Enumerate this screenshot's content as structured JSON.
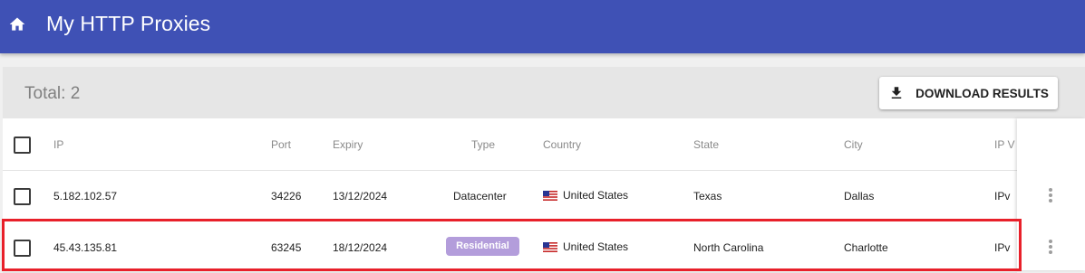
{
  "appbar": {
    "title": "My HTTP Proxies",
    "color": "#3f51b5"
  },
  "toolbar": {
    "total": "Total: 2",
    "download_label": "DOWNLOAD RESULTS"
  },
  "table": {
    "headers": {
      "ip": "IP",
      "port": "Port",
      "expiry": "Expiry",
      "type": "Type",
      "country": "Country",
      "state": "State",
      "city": "City",
      "ip_version": "IP V"
    },
    "rows": [
      {
        "ip": "5.182.102.57",
        "port": "34226",
        "expiry": "13/12/2024",
        "type": "Datacenter",
        "country": "United States",
        "state": "Texas",
        "city": "Dallas",
        "ip_version": "IPv"
      },
      {
        "ip": "45.43.135.81",
        "port": "63245",
        "expiry": "18/12/2024",
        "type": "Residential",
        "country": "United States",
        "state": "North Carolina",
        "city": "Charlotte",
        "ip_version": "IPv"
      }
    ]
  },
  "icons": [
    "home-icon",
    "download-icon",
    "us-flag-icon",
    "more-vert-icon"
  ],
  "colors": {
    "residential_badge": "#b39ddb",
    "highlight_border": "#e8202a"
  }
}
